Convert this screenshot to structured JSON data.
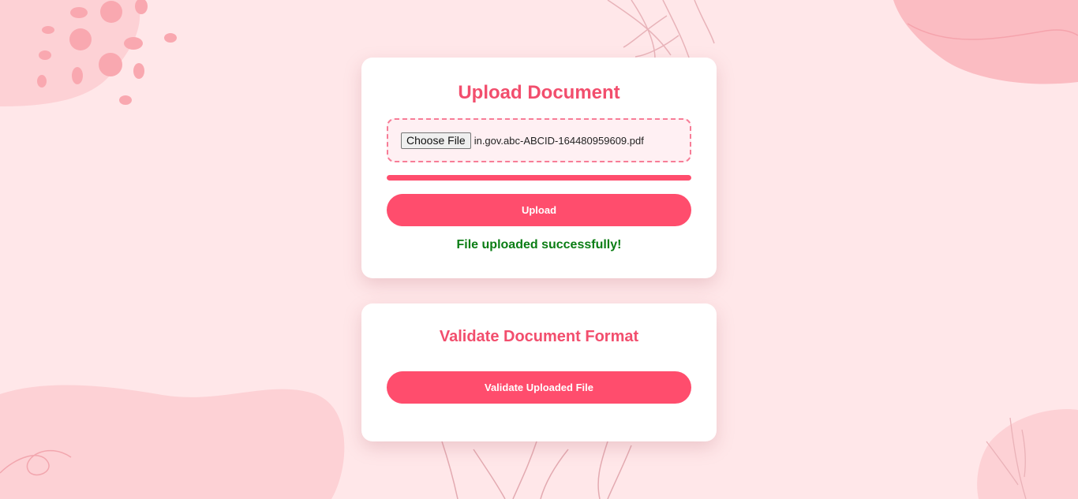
{
  "upload": {
    "title": "Upload Document",
    "choose_file_label": "Choose File",
    "file_name": "in.gov.abc-ABCID-164480959609.pdf",
    "progress_percent": 100,
    "upload_label": "Upload",
    "status_message": "File uploaded successfully!"
  },
  "validate": {
    "title": "Validate Document Format",
    "button_label": "Validate Uploaded File"
  },
  "colors": {
    "accent": "#ff4d6d",
    "title": "#f24e6d",
    "success": "#0a7d14",
    "background": "#ffe7e9"
  }
}
